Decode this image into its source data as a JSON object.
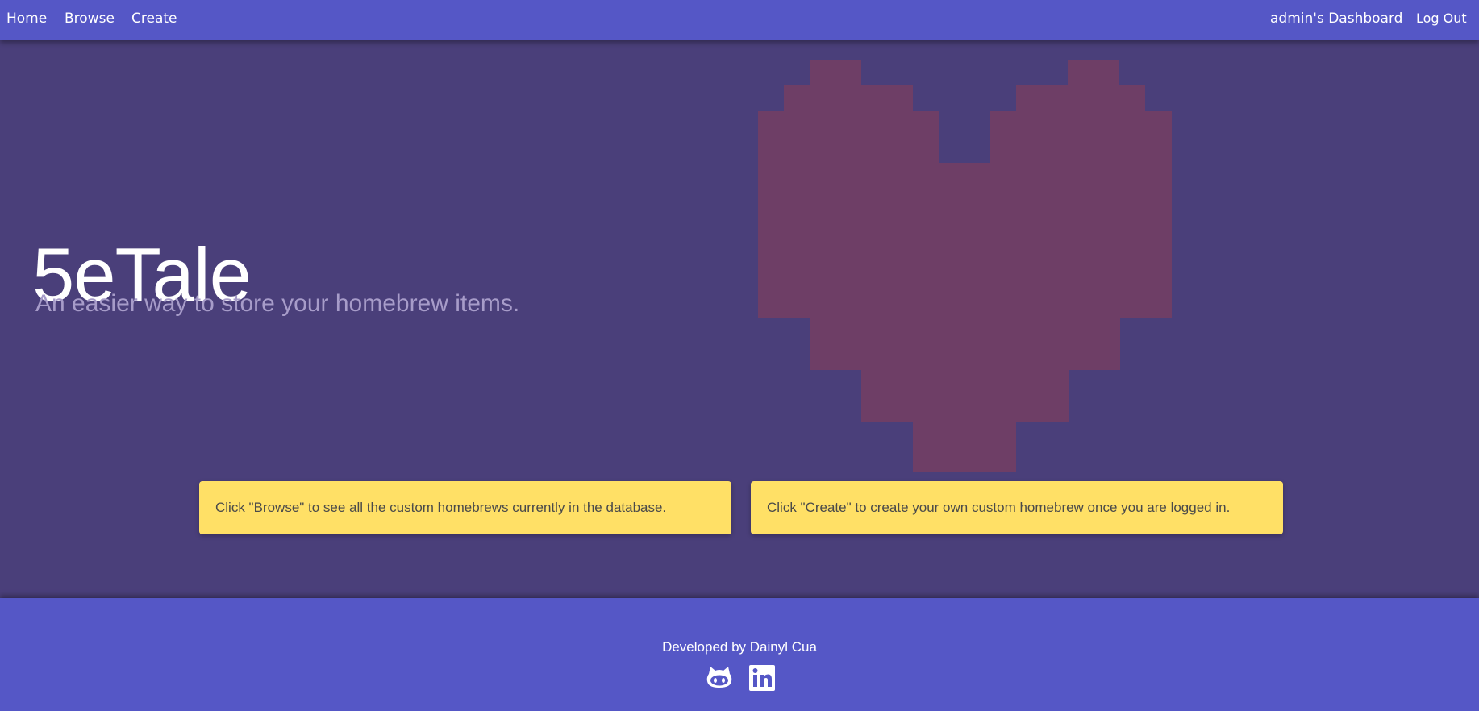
{
  "nav": {
    "home": "Home",
    "browse": "Browse",
    "create": "Create",
    "dashboard": "admin's Dashboard",
    "logout": "Log Out"
  },
  "hero": {
    "title": "5eTale",
    "subtitle": "An easier way to store your homebrew items."
  },
  "cards": {
    "browse_hint": "Click \"Browse\" to see all the custom homebrews currently in the database.",
    "create_hint": "Click \"Create\" to create your own custom homebrew once you are logged in."
  },
  "footer": {
    "credit": "Developed by Dainyl Cua",
    "icons": [
      "github-icon",
      "linkedin-icon"
    ]
  },
  "colors": {
    "navbar": "#5557c6",
    "background": "#4a3f7a",
    "heart": "#6e3e66",
    "card": "#ffe066",
    "subtitle": "#a79cc9"
  }
}
